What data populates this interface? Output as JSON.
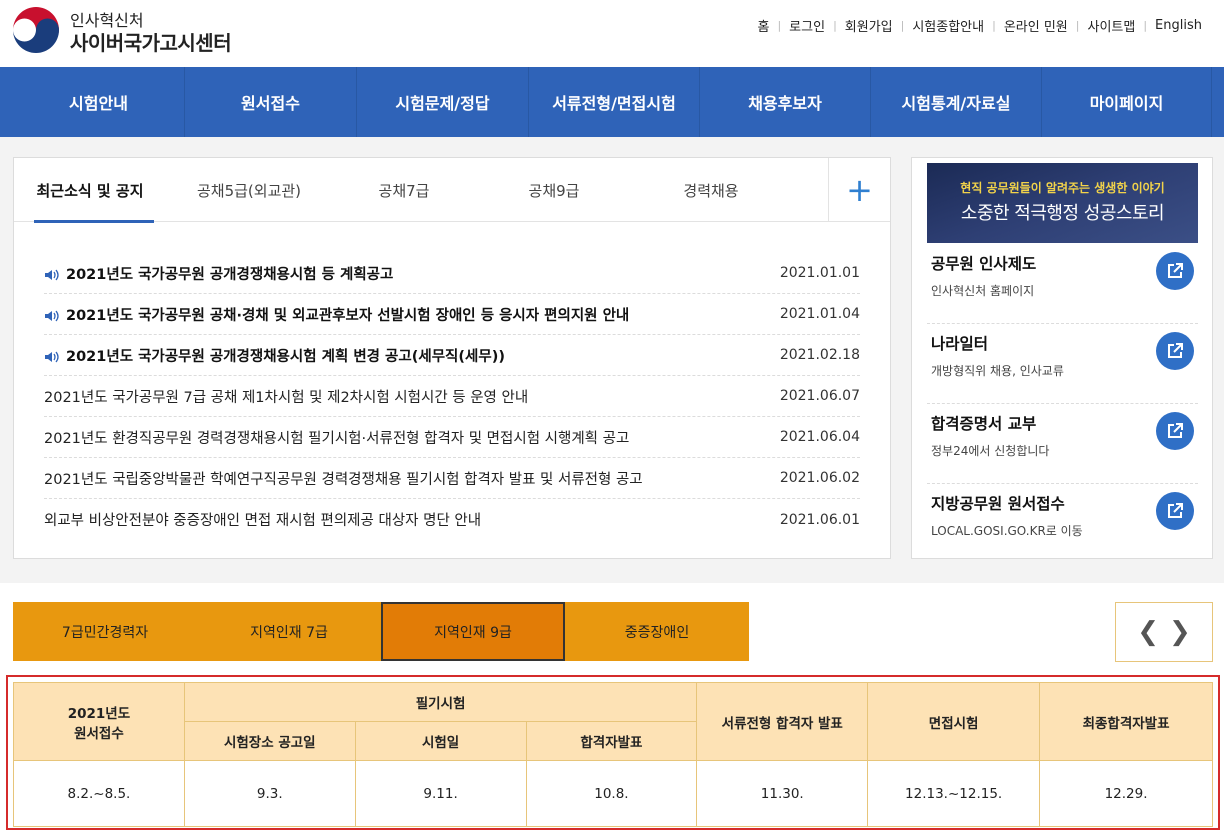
{
  "header": {
    "org": "인사혁신처",
    "title": "사이버국가고시센터",
    "util_links": [
      "홈",
      "로그인",
      "회원가입",
      "시험종합안내",
      "온라인 민원",
      "사이트맵",
      "English"
    ]
  },
  "nav": [
    "시험안내",
    "원서접수",
    "시험문제/정답",
    "서류전형/면접시험",
    "채용후보자",
    "시험통계/자료실",
    "마이페이지"
  ],
  "notice": {
    "tabs": [
      "최근소식 및 공지",
      "공채5급(외교관)",
      "공채7급",
      "공채9급",
      "경력채용"
    ],
    "more": "+",
    "items": [
      {
        "title": "2021년도 국가공무원 공개경쟁채용시험 등 계획공고",
        "date": "2021.01.01",
        "hot": true
      },
      {
        "title": "2021년도 국가공무원 공채·경채 및 외교관후보자 선발시험 장애인 등 응시자 편의지원 안내",
        "date": "2021.01.04",
        "hot": true
      },
      {
        "title": "2021년도 국가공무원 공개경쟁채용시험 계획 변경 공고(세무직(세무))",
        "date": "2021.02.18",
        "hot": true
      },
      {
        "title": "2021년도 국가공무원 7급 공채 제1차시험 및 제2차시험 시험시간 등 운영 안내",
        "date": "2021.06.07",
        "hot": false
      },
      {
        "title": "2021년도 환경직공무원 경력경쟁채용시험 필기시험·서류전형 합격자 및 면접시험 시행계획 공고",
        "date": "2021.06.04",
        "hot": false
      },
      {
        "title": "2021년도 국립중앙박물관 학예연구직공무원 경력경쟁채용 필기시험 합격자 발표 및 서류전형 공고",
        "date": "2021.06.02",
        "hot": false
      },
      {
        "title": "외교부 비상안전분야 중증장애인 면접 재시험 편의제공 대상자 명단 안내",
        "date": "2021.06.01",
        "hot": false
      }
    ]
  },
  "banner": {
    "line1": "현직 공무원들이 알려주는 생생한 이야기",
    "line2": "소중한 적극행정 성공스토리"
  },
  "quick_links": [
    {
      "title": "공무원 인사제도",
      "sub": "인사혁신처 홈페이지"
    },
    {
      "title": "나라일터",
      "sub": "개방형직위 채용, 인사교류"
    },
    {
      "title": "합격증명서 교부",
      "sub": "정부24에서 신청합니다"
    },
    {
      "title": "지방공무원 원서접수",
      "sub": "LOCAL.GOSI.GO.KR로 이동"
    }
  ],
  "exam_tabs": [
    "7급민간경력자",
    "지역인재 7급",
    "지역인재 9급",
    "중증장애인"
  ],
  "active_exam_tab": 2,
  "schedule": {
    "h_apply": "2021년도\n원서접수",
    "h_written": "필기시험",
    "h_place": "시험장소 공고일",
    "h_examday": "시험일",
    "h_pass": "합격자발표",
    "h_doc": "서류전형 합격자 발표",
    "h_interview": "면접시험",
    "h_final": "최종합격자발표",
    "values": [
      "8.2.~8.5.",
      "9.3.",
      "9.11.",
      "10.8.",
      "11.30.",
      "12.13.~12.15.",
      "12.29."
    ]
  },
  "colors": {
    "nav": "#2f63b8",
    "tab_orange": "#e8980f",
    "tab_active": "#e27c06",
    "table_head": "#fde2b5",
    "highlight": "#d52b2b"
  }
}
